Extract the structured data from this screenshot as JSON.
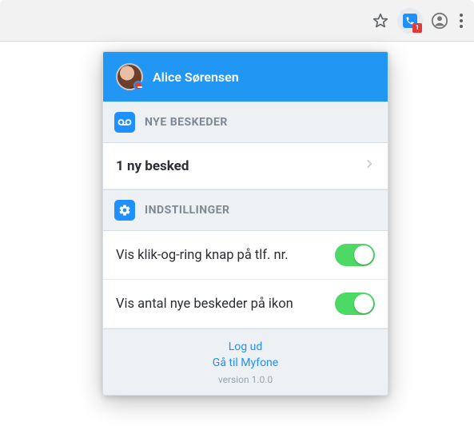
{
  "browser": {
    "extension_badge_count": "1"
  },
  "header": {
    "user_name": "Alice Sørensen"
  },
  "sections": {
    "messages": {
      "title": "NYE BESKEDER",
      "item_label": "1 ny besked"
    },
    "settings": {
      "title": "INDSTILLINGER",
      "options": [
        {
          "label": "Vis klik-og-ring knap på tlf. nr.",
          "enabled": true
        },
        {
          "label": "Vis antal nye beskeder på ikon",
          "enabled": true
        }
      ]
    }
  },
  "footer": {
    "logout_label": "Log ud",
    "goto_label": "Gå til Myfone",
    "version_label": "version 1.0.0"
  },
  "colors": {
    "primary": "#2196f3",
    "accent": "#1e90ff",
    "toggle_on": "#4cd964",
    "badge": "#e53935"
  }
}
